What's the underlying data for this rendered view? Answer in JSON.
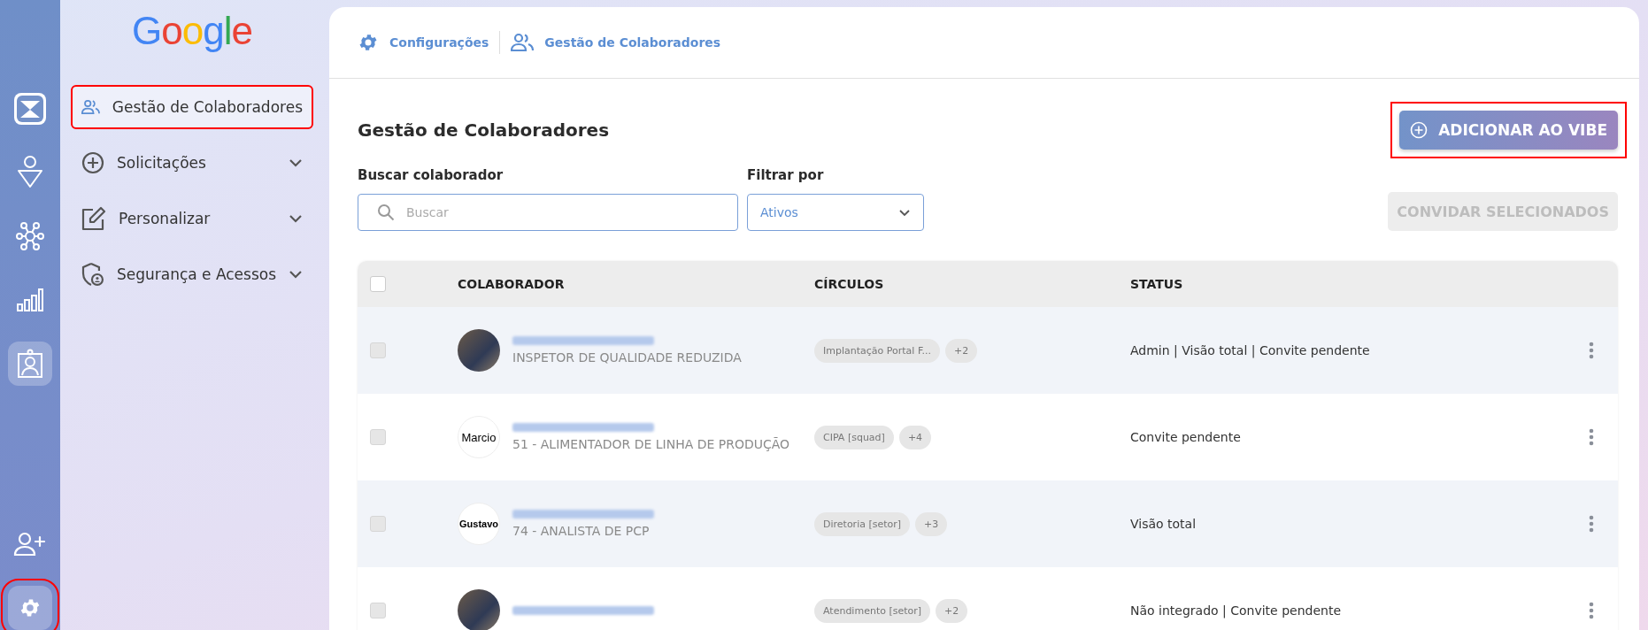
{
  "rail": {
    "items": [
      {
        "kind": "logo",
        "selected": false,
        "highlighted": false
      },
      {
        "kind": "ai",
        "selected": false,
        "highlighted": false
      },
      {
        "kind": "network",
        "selected": false,
        "highlighted": false
      },
      {
        "kind": "chart",
        "selected": false,
        "highlighted": false
      },
      {
        "kind": "badge",
        "selected": true,
        "highlighted": false
      },
      {
        "kind": "add-user",
        "selected": false,
        "highlighted": false
      },
      {
        "kind": "settings",
        "selected": true,
        "highlighted": true
      }
    ]
  },
  "sidebar": {
    "logo_text": "Google",
    "items": [
      {
        "label": "Gestão de Colaboradores",
        "selected": true,
        "highlighted": true,
        "expandable": false
      },
      {
        "label": "Solicitações",
        "selected": false,
        "highlighted": false,
        "expandable": true
      },
      {
        "label": "Personalizar",
        "selected": false,
        "highlighted": false,
        "expandable": true
      },
      {
        "label": "Segurança e Acessos",
        "selected": false,
        "highlighted": false,
        "expandable": true
      }
    ]
  },
  "breadcrumb": [
    {
      "label": "Configurações"
    },
    {
      "label": "Gestão de Colaboradores"
    }
  ],
  "page_title": "Gestão de Colaboradores",
  "add_button": {
    "label": "ADICIONAR AO VIBE",
    "highlighted": true
  },
  "search": {
    "label": "Buscar colaborador",
    "placeholder": "Buscar"
  },
  "filter": {
    "label": "Filtrar por",
    "value": "Ativos"
  },
  "invite_button": {
    "label": "CONVIDAR SELECIONADOS",
    "disabled": true
  },
  "table": {
    "select_all": {
      "checked": false
    },
    "columns": [
      "COLABORADOR",
      "CÍRCULOS",
      "STATUS"
    ],
    "rows": [
      {
        "kind": "photo",
        "job": "INSPETOR DE QUALIDADE REDUZIDA",
        "circles": [
          "Implantação Portal F...",
          "+2"
        ],
        "status": "Admin | Visão total | Convite pendente",
        "checked": false
      },
      {
        "kind": "text",
        "avatar_text": "Marcio",
        "job": "51 - ALIMENTADOR DE LINHA DE PRODUÇÃO",
        "circles": [
          "CIPA [squad]",
          "+4"
        ],
        "status": "Convite pendente",
        "checked": false
      },
      {
        "kind": "text",
        "avatar_text": "Gustavo",
        "job": "74 - ANALISTA DE PCP",
        "circles": [
          "Diretoria [setor]",
          "+3"
        ],
        "status": "Visão total",
        "checked": false
      },
      {
        "kind": "photo",
        "circles": [
          "Atendimento [setor]",
          "+2"
        ],
        "status": "Não integrado | Convite pendente",
        "checked": false
      }
    ]
  }
}
